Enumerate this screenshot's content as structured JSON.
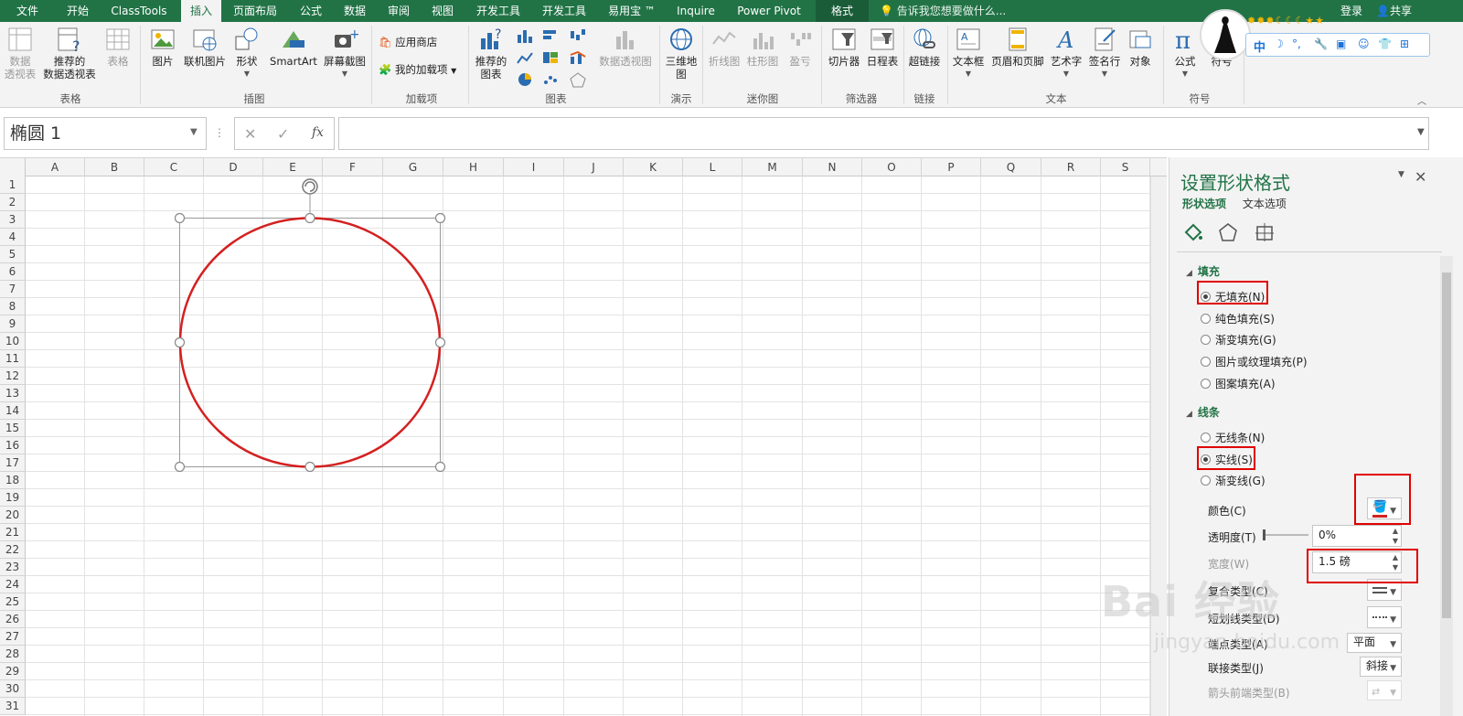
{
  "tabs": [
    {
      "label": "文件"
    },
    {
      "label": "开始"
    },
    {
      "label": "ClassTools"
    },
    {
      "label": "插入"
    },
    {
      "label": "页面布局"
    },
    {
      "label": "公式"
    },
    {
      "label": "数据"
    },
    {
      "label": "审阅"
    },
    {
      "label": "视图"
    },
    {
      "label": "开发工具"
    },
    {
      "label": "开发工具"
    },
    {
      "label": "易用宝 ™"
    },
    {
      "label": "Inquire"
    },
    {
      "label": "Power Pivot"
    },
    {
      "label": "格式"
    }
  ],
  "tell_me": "告诉我您想要做什么...",
  "login": "登录",
  "share": "共享",
  "ribbon": {
    "pivot_table": "数据\n透视表",
    "recommended_pivot": "推荐的\n数据透视表",
    "table": "表格",
    "group_tables": "表格",
    "pictures": "图片",
    "online_pictures": "联机图片",
    "shapes": "形状",
    "smartart": "SmartArt",
    "screenshot": "屏幕截图",
    "group_illustrations": "插图",
    "store": "应用商店",
    "my_addins": "我的加载项",
    "group_addins": "加载项",
    "recommended_charts": "推荐的\n图表",
    "pivot_chart": "数据透视图",
    "group_charts": "图表",
    "map_3d": "三维地\n图",
    "group_tours": "演示",
    "spark_line": "折线图",
    "spark_column": "柱形图",
    "spark_winloss": "盈亏",
    "group_sparklines": "迷你图",
    "slicer": "切片器",
    "timeline": "日程表",
    "group_filters": "筛选器",
    "hyperlink": "超链接",
    "group_links": "链接",
    "textbox": "文本框",
    "header_footer": "页眉和页脚",
    "wordart": "艺术字",
    "signature": "签名行",
    "object": "对象",
    "group_text": "文本",
    "equation": "公式",
    "symbol": "符号",
    "group_symbols": "符号"
  },
  "ime": {
    "lang": "中"
  },
  "formula_bar": {
    "name_box": "椭圆 1",
    "fx": "fx",
    "cancel": "✕",
    "enter": "✓",
    "formula": ""
  },
  "columns": [
    "A",
    "B",
    "C",
    "D",
    "E",
    "F",
    "G",
    "H",
    "I",
    "J",
    "K",
    "L",
    "M",
    "N",
    "O",
    "P",
    "Q",
    "R",
    "S"
  ],
  "rows": [
    "1",
    "2",
    "3",
    "4",
    "5",
    "6",
    "7",
    "8",
    "9",
    "10",
    "11",
    "12",
    "13",
    "14",
    "15",
    "16",
    "17",
    "18",
    "19",
    "20",
    "21",
    "22",
    "23",
    "24",
    "25",
    "26",
    "27",
    "28",
    "29",
    "30",
    "31"
  ],
  "shape": {
    "stroke_color": "#d42020"
  },
  "pane": {
    "title": "设置形状格式",
    "tab_shape": "形状选项",
    "tab_text": "文本选项",
    "fill_section": "填充",
    "fill_options": [
      "无填充(N)",
      "纯色填充(S)",
      "渐变填充(G)",
      "图片或纹理填充(P)",
      "图案填充(A)"
    ],
    "line_section": "线条",
    "line_options": [
      "无线条(N)",
      "实线(S)",
      "渐变线(G)"
    ],
    "color_label": "颜色(C)",
    "transparency_label": "透明度(T)",
    "transparency_value": "0%",
    "width_label": "宽度(W)",
    "width_value": "1.5 磅",
    "compound_label": "复合类型(C)",
    "dash_label": "短划线类型(D)",
    "cap_label": "端点类型(A)",
    "cap_value": "平面",
    "join_label": "联接类型(J)",
    "join_value": "斜接",
    "arrow_label": "箭头前端类型(B)"
  },
  "watermark": {
    "brand": "Bai 经验",
    "url": "jingyan.baidu.com"
  }
}
